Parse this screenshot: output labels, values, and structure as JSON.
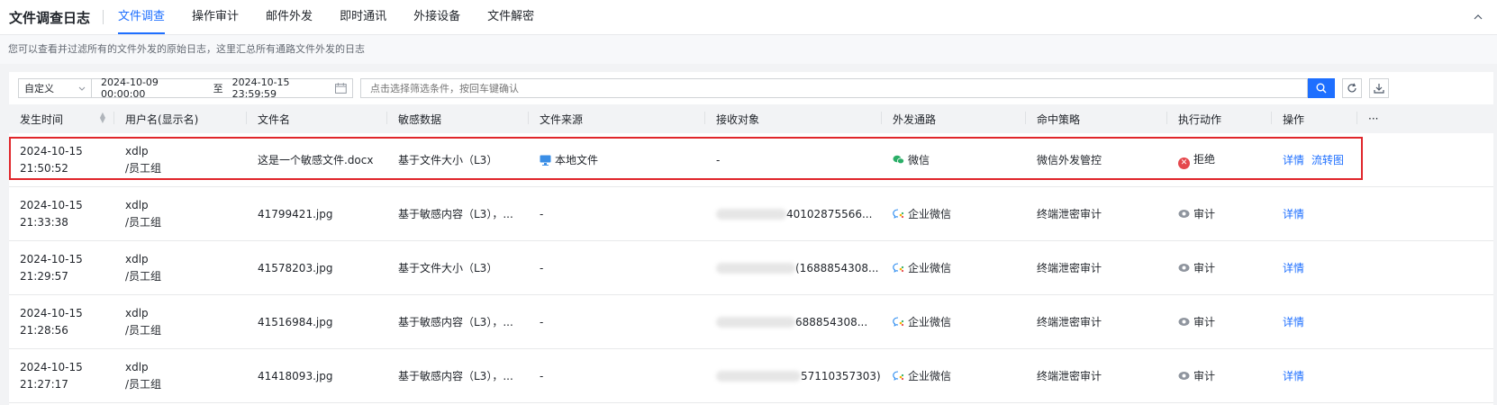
{
  "app": {
    "title": "文件调查日志"
  },
  "tabs": [
    {
      "label": "文件调查",
      "active": true
    },
    {
      "label": "操作审计",
      "active": false
    },
    {
      "label": "邮件外发",
      "active": false
    },
    {
      "label": "即时通讯",
      "active": false
    },
    {
      "label": "外接设备",
      "active": false
    },
    {
      "label": "文件解密",
      "active": false
    }
  ],
  "description": "您可以查看并过滤所有的文件外发的原始日志，这里汇总所有通路文件外发的日志",
  "filter": {
    "range_type": "自定义",
    "start": "2024-10-09 00:00:00",
    "to_label": "至",
    "end": "2024-10-15 23:59:59",
    "search_placeholder": "点击选择筛选条件，按回车键确认"
  },
  "columns": [
    "发生时间",
    "用户名(显示名)",
    "文件名",
    "敏感数据",
    "文件来源",
    "接收对象",
    "外发通路",
    "命中策略",
    "执行动作",
    "操作",
    "···"
  ],
  "rows": [
    {
      "date": "2024-10-15",
      "time": "21:50:52",
      "user": "xdlp",
      "group": "/员工组",
      "file": "这是一个敏感文件.docx",
      "sensitive": "基于文件大小（L3）",
      "source": "本地文件",
      "recipient": "-",
      "channel": "微信",
      "policy": "微信外发管控",
      "action": "拒绝",
      "ops": [
        "详情",
        "流转图"
      ]
    },
    {
      "date": "2024-10-15",
      "time": "21:33:38",
      "user": "xdlp",
      "group": "/员工组",
      "file": "41799421.jpg",
      "sensitive": "基于敏感内容（L3），...",
      "source": "-",
      "recipient": "40102875566...",
      "channel": "企业微信",
      "policy": "终端泄密审计",
      "action": "审计",
      "ops": [
        "详情"
      ]
    },
    {
      "date": "2024-10-15",
      "time": "21:29:57",
      "user": "xdlp",
      "group": "/员工组",
      "file": "41578203.jpg",
      "sensitive": "基于文件大小（L3）",
      "source": "-",
      "recipient": "(1688854308...",
      "channel": "企业微信",
      "policy": "终端泄密审计",
      "action": "审计",
      "ops": [
        "详情"
      ]
    },
    {
      "date": "2024-10-15",
      "time": "21:28:56",
      "user": "xdlp",
      "group": "/员工组",
      "file": "41516984.jpg",
      "sensitive": "基于敏感内容（L3），...",
      "source": "-",
      "recipient": "688854308...",
      "channel": "企业微信",
      "policy": "终端泄密审计",
      "action": "审计",
      "ops": [
        "详情"
      ]
    },
    {
      "date": "2024-10-15",
      "time": "21:27:17",
      "user": "xdlp",
      "group": "/员工组",
      "file": "41418093.jpg",
      "sensitive": "基于敏感内容（L3），...",
      "source": "-",
      "recipient": "57110357303)",
      "channel": "企业微信",
      "policy": "终端泄密审计",
      "action": "审计",
      "ops": [
        "详情"
      ]
    }
  ],
  "colors": {
    "accent": "#1e6fff",
    "reject": "#e5484d",
    "highlight": "#e0262b"
  }
}
